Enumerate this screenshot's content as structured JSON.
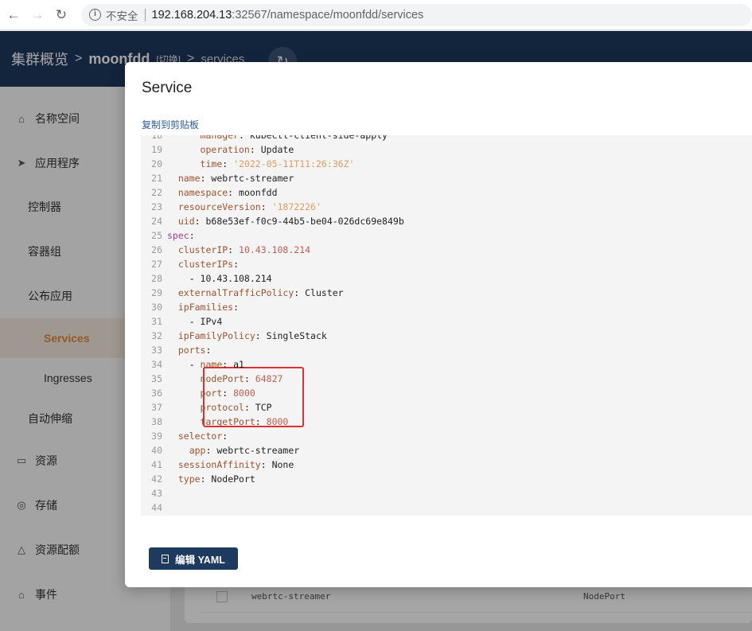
{
  "browser": {
    "back": "←",
    "forward": "→",
    "reload": "↻",
    "info": "i",
    "insecure_label": "不安全",
    "url_host": "192.168.204.13",
    "url_rest": ":32567/namespace/moonfdd/services"
  },
  "header": {
    "crumb1": "集群概览",
    "arrow": ">",
    "crumb2": "moonfdd",
    "switch_label": "[切换]",
    "crumb3": "services",
    "refresh": "↻"
  },
  "sidebar": {
    "items": [
      {
        "label": "名称空间",
        "icon": "home-icon",
        "glyph": "⌂"
      },
      {
        "label": "应用程序",
        "icon": "send-icon",
        "glyph": "➤"
      },
      {
        "label": "控制器"
      },
      {
        "label": "容器组"
      },
      {
        "label": "公布应用"
      },
      {
        "label": "Services"
      },
      {
        "label": "Ingresses"
      },
      {
        "label": "自动伸缩"
      },
      {
        "label": "资源",
        "icon": "box-icon",
        "glyph": "▭"
      },
      {
        "label": "存储",
        "icon": "database-icon",
        "glyph": "◎"
      },
      {
        "label": "资源配额",
        "icon": "quota-icon",
        "glyph": "△"
      },
      {
        "label": "事件",
        "icon": "bell-icon",
        "glyph": "⌂"
      }
    ]
  },
  "background_table": {
    "row": {
      "name": "webrtc-streamer",
      "type": "NodePort"
    }
  },
  "dialog": {
    "title": "Service",
    "copy_label": "复制到剪贴板",
    "edit_label": "编辑 YAML",
    "lines": [
      {
        "n": "18",
        "indent": "      ",
        "k": "manager",
        "v": "kubectl-client-side-apply",
        "vt": "v"
      },
      {
        "n": "19",
        "indent": "      ",
        "k": "operation",
        "v": "Update",
        "vt": "v"
      },
      {
        "n": "20",
        "indent": "      ",
        "k": "time",
        "v": "'2022-05-11T11:26:36Z'",
        "vt": "str"
      },
      {
        "n": "21",
        "indent": "  ",
        "k": "name",
        "v": "webrtc-streamer",
        "vt": "v"
      },
      {
        "n": "22",
        "indent": "  ",
        "k": "namespace",
        "v": "moonfdd",
        "vt": "v"
      },
      {
        "n": "23",
        "indent": "  ",
        "k": "resourceVersion",
        "v": "'1872226'",
        "vt": "str"
      },
      {
        "n": "24",
        "indent": "  ",
        "k": "uid",
        "v": "b68e53ef-f0c9-44b5-be04-026dc69e849b",
        "vt": "v"
      },
      {
        "n": "25",
        "indent": "",
        "k": "spec",
        "v": "",
        "vt": "v"
      },
      {
        "n": "26",
        "indent": "  ",
        "k": "clusterIP",
        "v": "10.43.108.214",
        "vt": "num"
      },
      {
        "n": "27",
        "indent": "  ",
        "k": "clusterIPs",
        "v": "",
        "vt": "v"
      },
      {
        "n": "28",
        "indent": "    - ",
        "k": "",
        "v": "10.43.108.214",
        "vt": "v"
      },
      {
        "n": "29",
        "indent": "  ",
        "k": "externalTrafficPolicy",
        "v": "Cluster",
        "vt": "v"
      },
      {
        "n": "30",
        "indent": "  ",
        "k": "ipFamilies",
        "v": "",
        "vt": "v"
      },
      {
        "n": "31",
        "indent": "    - ",
        "k": "",
        "v": "IPv4",
        "vt": "v"
      },
      {
        "n": "32",
        "indent": "  ",
        "k": "ipFamilyPolicy",
        "v": "SingleStack",
        "vt": "v"
      },
      {
        "n": "33",
        "indent": "  ",
        "k": "ports",
        "v": "",
        "vt": "v"
      },
      {
        "n": "34",
        "indent": "    - ",
        "k": "name",
        "v": "a1",
        "vt": "v"
      },
      {
        "n": "35",
        "indent": "      ",
        "k": "nodePort",
        "v": "64827",
        "vt": "num"
      },
      {
        "n": "36",
        "indent": "      ",
        "k": "port",
        "v": "8000",
        "vt": "num"
      },
      {
        "n": "37",
        "indent": "      ",
        "k": "protocol",
        "v": "TCP",
        "vt": "v"
      },
      {
        "n": "38",
        "indent": "      ",
        "k": "targetPort",
        "v": "8000",
        "vt": "num"
      },
      {
        "n": "39",
        "indent": "  ",
        "k": "selector",
        "v": "",
        "vt": "v"
      },
      {
        "n": "40",
        "indent": "    ",
        "k": "app",
        "v": "webrtc-streamer",
        "vt": "v"
      },
      {
        "n": "41",
        "indent": "  ",
        "k": "sessionAffinity",
        "v": "None",
        "vt": "v"
      },
      {
        "n": "42",
        "indent": "  ",
        "k": "type",
        "v": "NodePort",
        "vt": "v"
      },
      {
        "n": "43",
        "indent": "",
        "k": "",
        "v": "",
        "vt": "v"
      },
      {
        "n": "44",
        "indent": "",
        "k": "",
        "v": "",
        "vt": "v"
      }
    ]
  }
}
